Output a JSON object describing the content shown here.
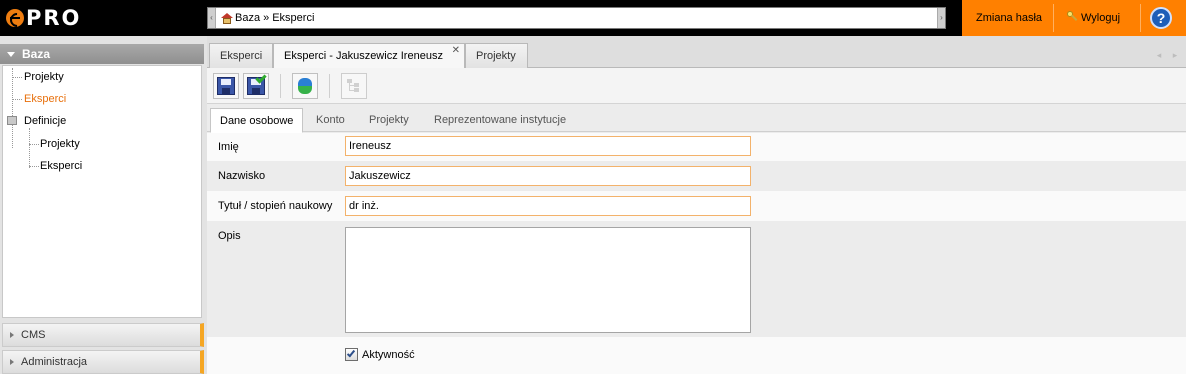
{
  "app": {
    "brand": "PRO"
  },
  "breadcrumb": {
    "home": "Baza",
    "separator": "»",
    "current": "Eksperci"
  },
  "header_links": {
    "change_password": "Zmiana hasła",
    "logout": "Wyloguj",
    "help": "?"
  },
  "sidebar": {
    "title": "Baza",
    "items": [
      {
        "label": "Projekty",
        "active": false
      },
      {
        "label": "Eksperci",
        "active": true
      },
      {
        "label": "Definicje",
        "active": false
      },
      {
        "label": "Projekty",
        "active": false
      },
      {
        "label": "Eksperci",
        "active": false
      }
    ],
    "sections": [
      {
        "label": "CMS"
      },
      {
        "label": "Administracja"
      }
    ]
  },
  "doc_tabs": [
    {
      "label": "Eksperci",
      "active": false
    },
    {
      "label": "Eksperci - Jakuszewicz Ireneusz",
      "active": true,
      "closable": true
    },
    {
      "label": "Projekty",
      "active": false
    }
  ],
  "toolbar": {
    "buttons": [
      "save-icon",
      "save-and-close-icon",
      "refresh-icon",
      "tree-view-icon"
    ]
  },
  "form_tabs": [
    {
      "label": "Dane osobowe",
      "active": true
    },
    {
      "label": "Konto",
      "active": false
    },
    {
      "label": "Projekty",
      "active": false
    },
    {
      "label": "Reprezentowane instytucje",
      "active": false
    }
  ],
  "form": {
    "first_name": {
      "label": "Imię",
      "value": "Ireneusz"
    },
    "last_name": {
      "label": "Nazwisko",
      "value": "Jakuszewicz"
    },
    "title": {
      "label": "Tytuł / stopień naukowy",
      "value": "dr inż."
    },
    "description": {
      "label": "Opis",
      "value": ""
    },
    "active": {
      "label": "Aktywność",
      "checked": true
    }
  },
  "colors": {
    "accent": "#ff8000",
    "active_text": "#e8700c",
    "input_border": "#f3b26b"
  }
}
